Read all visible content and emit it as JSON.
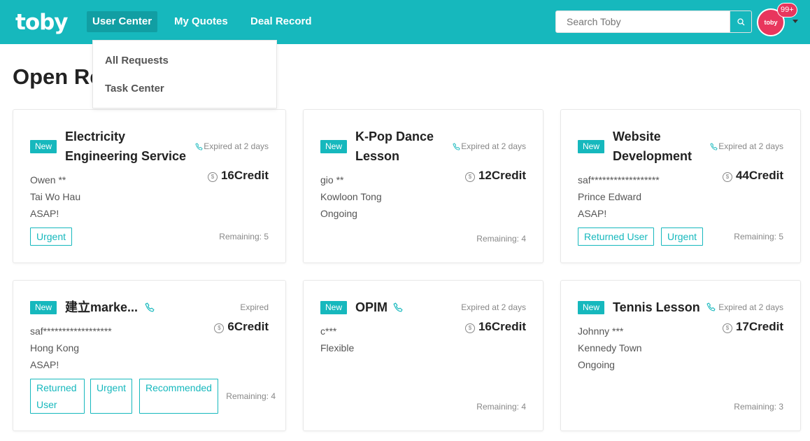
{
  "header": {
    "logo": "toby",
    "nav": [
      "User Center",
      "My Quotes",
      "Deal Record"
    ],
    "search_placeholder": "Search Toby",
    "avatar_text": "toby",
    "notification_badge": "99+"
  },
  "dropdown": {
    "items": [
      "All Requests",
      "Task Center"
    ]
  },
  "page": {
    "title": "Open Re"
  },
  "cards": [
    {
      "tag": "New",
      "title_line1": "Electricity",
      "title_line2": "Engineering Service",
      "expire": "Expired at 2 days",
      "credit": "16Credit",
      "user": "Owen **",
      "location": "Tai Wo Hau",
      "timing": "ASAP!",
      "tags": [
        "Urgent"
      ],
      "remaining": "Remaining: 5"
    },
    {
      "tag": "New",
      "title_line1": "K-Pop Dance",
      "title_line2": "Lesson",
      "expire": "Expired at 2 days",
      "credit": "12Credit",
      "user": "gio **",
      "location": "Kowloon Tong",
      "timing": "Ongoing",
      "tags": [],
      "remaining": "Remaining: 4"
    },
    {
      "tag": "New",
      "title_line1": "Website",
      "title_line2": "Development",
      "expire": "Expired at 2 days",
      "credit": "44Credit",
      "user": "saf******************",
      "location": "Prince Edward",
      "timing": "ASAP!",
      "tags": [
        "Returned User",
        "Urgent"
      ],
      "remaining": "Remaining: 5"
    },
    {
      "tag": "New",
      "title_line1": "建立marke...",
      "expire": "Expired",
      "credit": "6Credit",
      "user": "saf******************",
      "location": "Hong Kong",
      "timing": "ASAP!",
      "tags": [
        "Returned User",
        "Urgent",
        "Recommended"
      ],
      "remaining": "Remaining: 4"
    },
    {
      "tag": "New",
      "title_line1": "OPIM",
      "expire": "Expired at 2 days",
      "credit": "16Credit",
      "user": "c***",
      "location": "Flexible",
      "tags": [],
      "remaining": "Remaining: 4"
    },
    {
      "tag": "New",
      "title_line1": "Tennis Lesson",
      "expire": "Expired at 2 days",
      "credit": "17Credit",
      "user": "Johnny ***",
      "location": "Kennedy Town",
      "timing": "Ongoing",
      "tags": [],
      "remaining": "Remaining: 3"
    }
  ],
  "colors": {
    "brand": "#16b8bd",
    "brand_dark": "#119ea3",
    "avatar": "#e8365d"
  }
}
